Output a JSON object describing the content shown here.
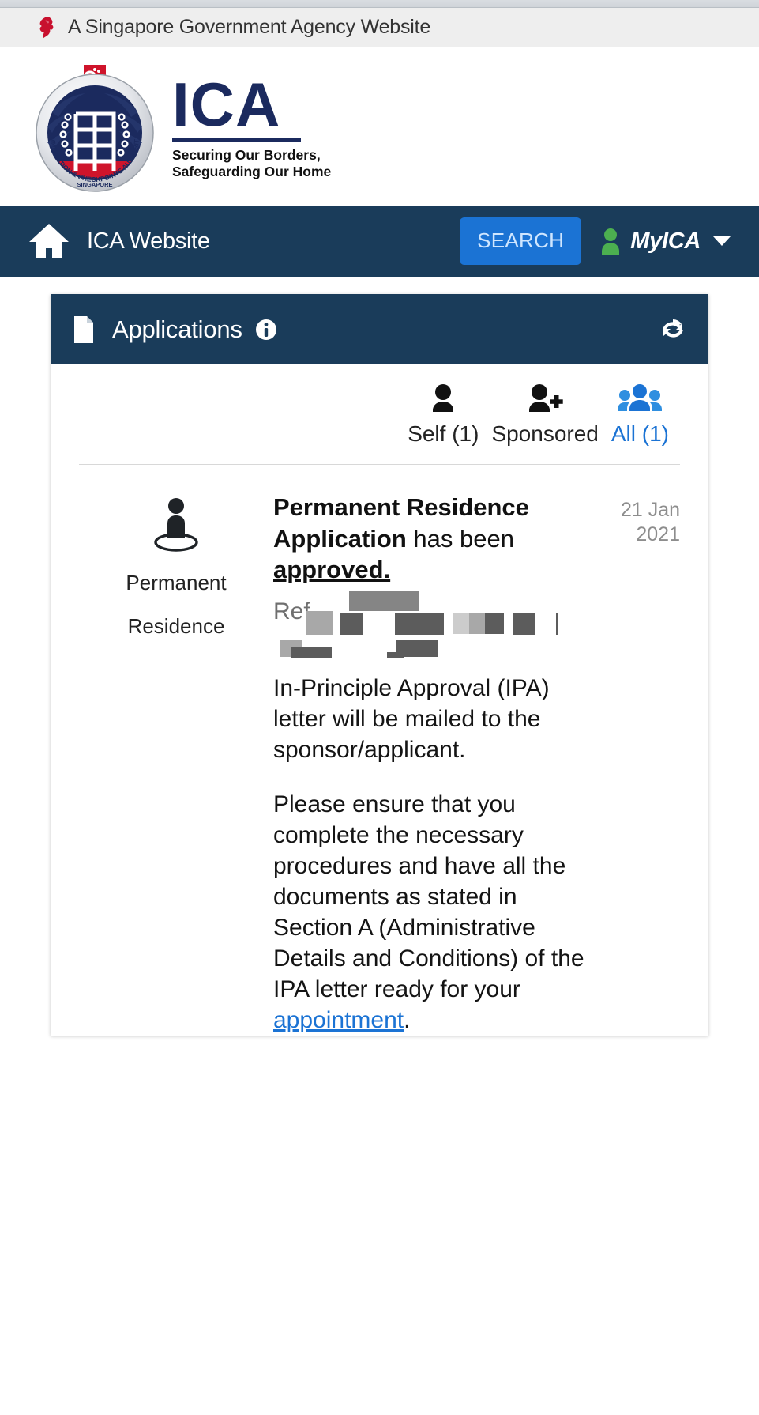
{
  "gov_banner": {
    "text": "A Singapore Government Agency Website",
    "icon": "singapore-lion-icon"
  },
  "masthead": {
    "logo_icon": "ica-crest-icon",
    "wordmark": "ICA",
    "tagline_line1": "Securing Our Borders,",
    "tagline_line2": "Safeguarding Our Home"
  },
  "navbar": {
    "home_icon": "home-icon",
    "home_label": "ICA Website",
    "search_label": "SEARCH",
    "user_icon": "person-icon",
    "myica_label": "MyICA",
    "dropdown_icon": "chevron-down-icon",
    "accent_color": "#1b73d4",
    "bar_color": "#1a3c5a"
  },
  "card": {
    "doc_icon": "document-icon",
    "title": "Applications",
    "info_icon": "info-icon",
    "refresh_icon": "refresh-icon"
  },
  "tabs": [
    {
      "icon": "person-icon",
      "label": "Self (1)",
      "active": false
    },
    {
      "icon": "person-add-icon",
      "label": "Sponsored",
      "active": false
    },
    {
      "icon": "people-group-icon",
      "label": "All (1)",
      "active": true
    }
  ],
  "application": {
    "type_icon": "permanent-residence-icon",
    "type_label_line1": "Permanent",
    "type_label_line2": "Residence",
    "date_line1": "21 Jan",
    "date_line2": "2021",
    "heading_bold": "Permanent Residence Application",
    "heading_rest": " has been ",
    "heading_status": "approved.",
    "ref_label": "Ref",
    "ref_value_redacted": true,
    "paragraph_1": "In-Principle Approval (IPA) letter will be mailed to the sponsor/applicant.",
    "paragraph_2_before_link": "Please ensure that you complete the necessary procedures and have all the documents as stated in Section A (Administrative Details and Conditions) of the IPA letter ready for your ",
    "paragraph_2_link": "appointment",
    "paragraph_2_after_link": "."
  }
}
